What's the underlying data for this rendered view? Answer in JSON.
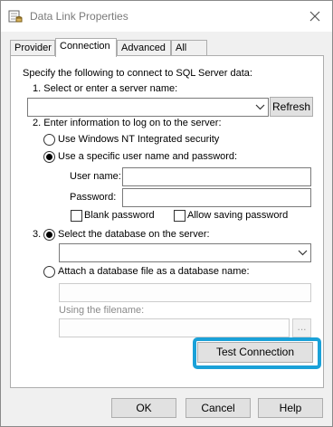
{
  "window": {
    "title": "Data Link Properties"
  },
  "tabs": [
    {
      "label": "Provider",
      "active": false
    },
    {
      "label": "Connection",
      "active": true
    },
    {
      "label": "Advanced",
      "active": false
    },
    {
      "label": "All",
      "active": false
    }
  ],
  "connection": {
    "intro": "Specify the following to connect to SQL Server data:",
    "step1_label": "1. Select or enter a server name:",
    "server_name_value": "",
    "refresh_label": "Refresh",
    "step2_label": "2. Enter information to log on to the server:",
    "radio_windows_nt": "Use Windows NT Integrated security",
    "radio_specific_user": "Use a specific user name and password:",
    "selected_auth": "specific_user",
    "user_name_label": "User name:",
    "user_name_value": "",
    "password_label": "Password:",
    "password_value": "",
    "blank_password_label": "Blank password",
    "blank_password_checked": false,
    "allow_saving_label": "Allow saving password",
    "allow_saving_checked": false,
    "step3_label": "3.",
    "radio_select_db": "Select the database on the server:",
    "database_value": "",
    "radio_attach_file": "Attach a database file as a database name:",
    "selected_db_mode": "select_db",
    "attach_db_name_value": "",
    "using_filename_label": "Using the filename:",
    "filename_value": "",
    "browse_label": "...",
    "test_connection_label": "Test Connection",
    "highlight_color": "#1aa1d8"
  },
  "footer": {
    "ok_label": "OK",
    "cancel_label": "Cancel",
    "help_label": "Help"
  }
}
